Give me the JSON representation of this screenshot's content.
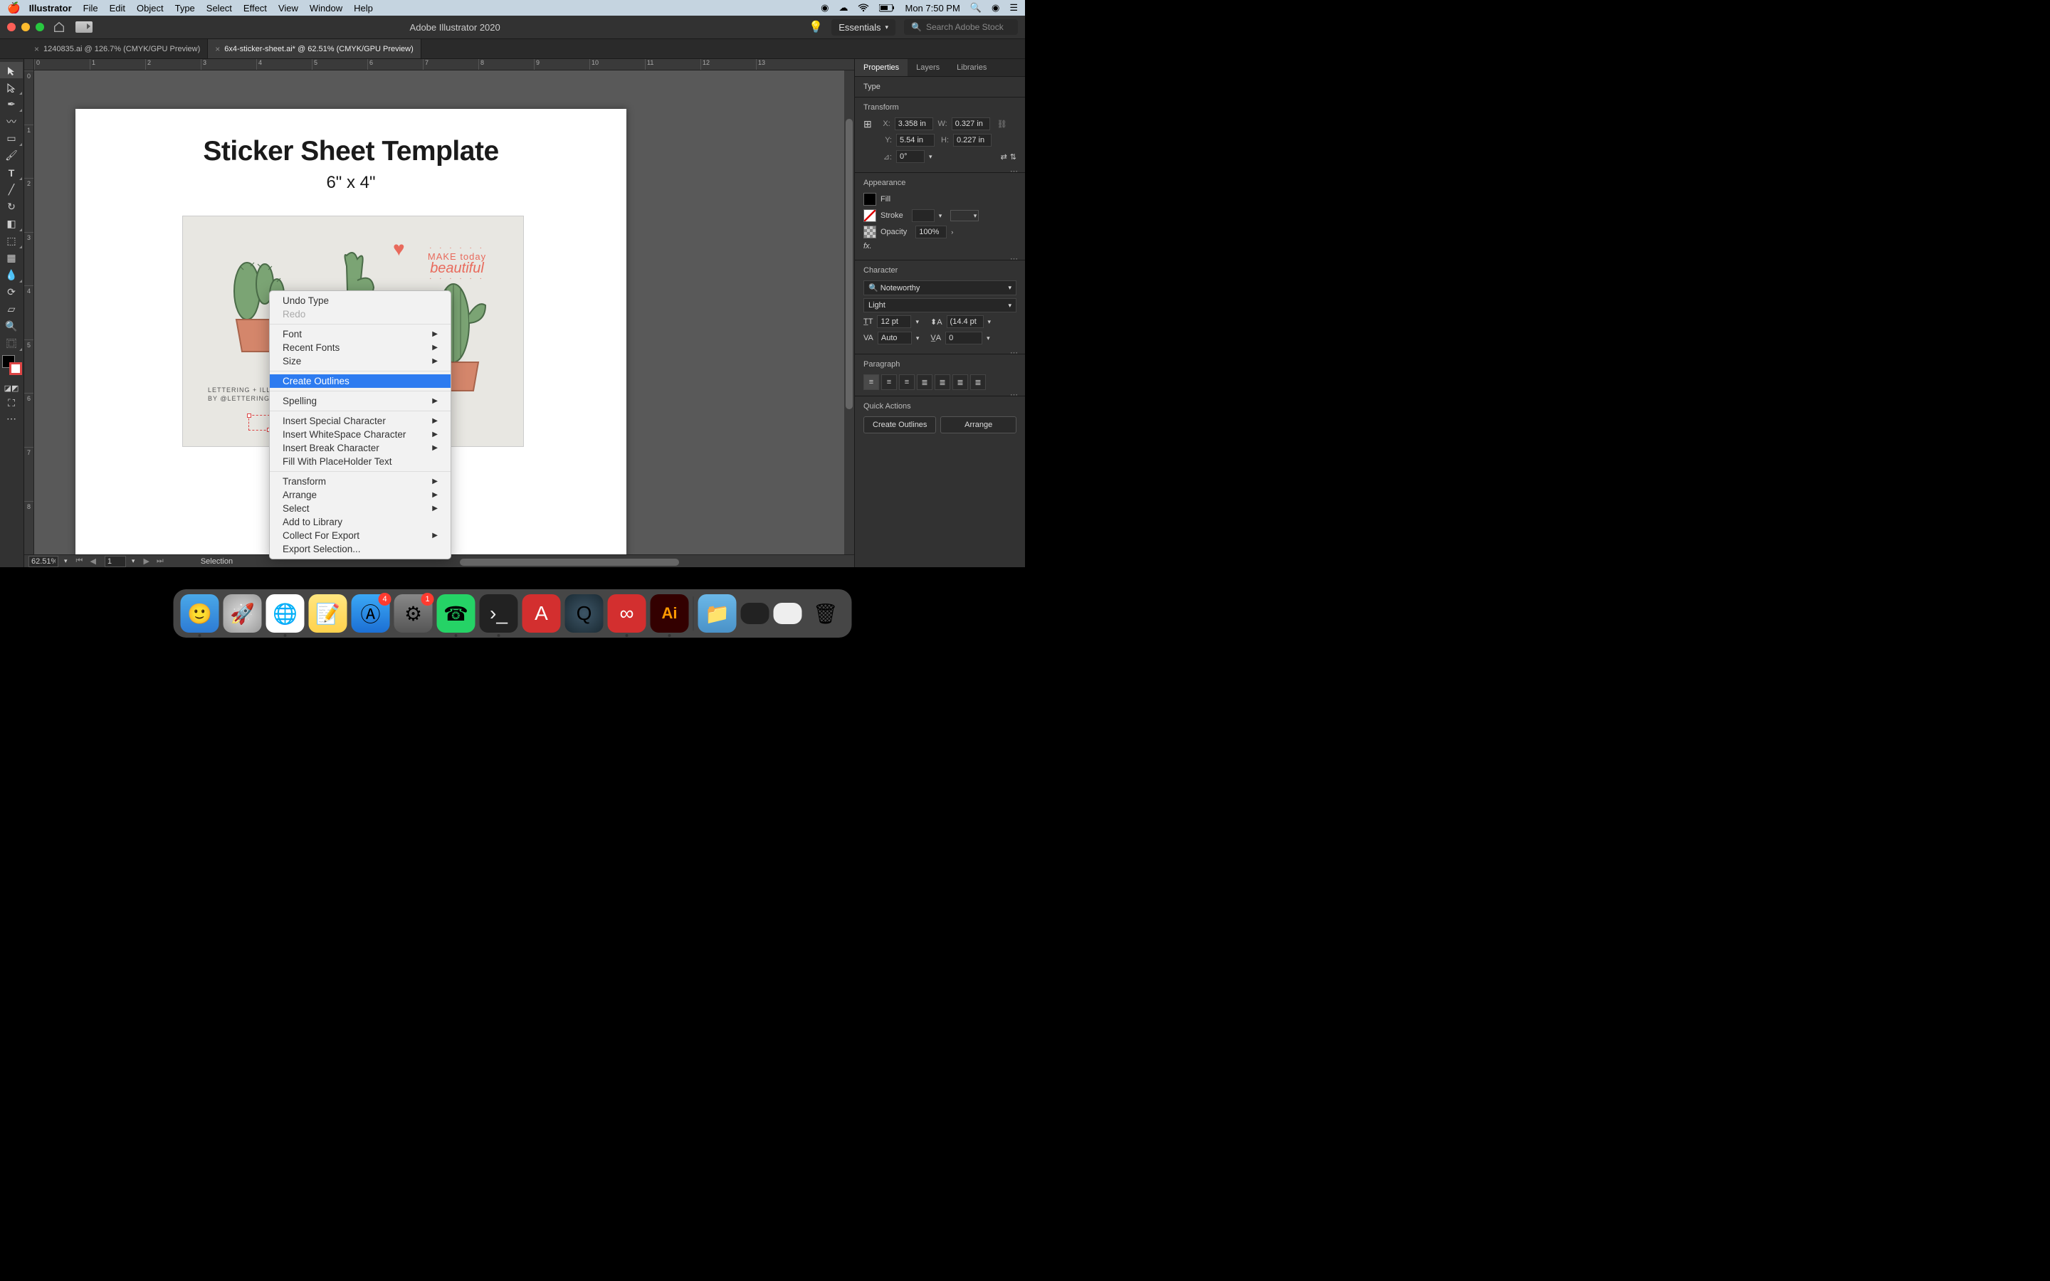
{
  "menubar": {
    "app": "Illustrator",
    "items": [
      "File",
      "Edit",
      "Object",
      "Type",
      "Select",
      "Effect",
      "View",
      "Window",
      "Help"
    ],
    "clock": "Mon 7:50 PM"
  },
  "titlebar": {
    "title": "Adobe Illustrator 2020",
    "workspace": "Essentials",
    "search_placeholder": "Search Adobe Stock"
  },
  "tabs": [
    {
      "label": "1240835.ai @ 126.7% (CMYK/GPU Preview)",
      "active": false
    },
    {
      "label": "6x4-sticker-sheet.ai* @ 62.51% (CMYK/GPU Preview)",
      "active": true
    }
  ],
  "ruler_h": [
    "0",
    "1",
    "2",
    "3",
    "4",
    "5",
    "6",
    "7",
    "8",
    "9",
    "10",
    "11",
    "12",
    "13"
  ],
  "ruler_v": [
    "0",
    "1",
    "2",
    "3",
    "4",
    "5",
    "6",
    "7",
    "8"
  ],
  "artboard": {
    "title": "Sticker Sheet Template",
    "subtitle": "6\" x 4\"",
    "credit_line1": "LETTERING + ILLUSTRATIONS",
    "credit_line2": "BY @LETTERINGBYLAURA",
    "make_today_1": "MAKE today",
    "make_today_2": "beautiful"
  },
  "context_menu": [
    {
      "label": "Undo Type",
      "type": "item"
    },
    {
      "label": "Redo",
      "type": "item",
      "disabled": true
    },
    {
      "type": "sep"
    },
    {
      "label": "Font",
      "type": "sub"
    },
    {
      "label": "Recent Fonts",
      "type": "sub"
    },
    {
      "label": "Size",
      "type": "sub"
    },
    {
      "type": "sep"
    },
    {
      "label": "Create Outlines",
      "type": "item",
      "highlight": true
    },
    {
      "type": "sep"
    },
    {
      "label": "Spelling",
      "type": "sub"
    },
    {
      "type": "sep"
    },
    {
      "label": "Insert Special Character",
      "type": "sub"
    },
    {
      "label": "Insert WhiteSpace Character",
      "type": "sub"
    },
    {
      "label": "Insert Break Character",
      "type": "sub"
    },
    {
      "label": "Fill With PlaceHolder Text",
      "type": "item"
    },
    {
      "type": "sep"
    },
    {
      "label": "Transform",
      "type": "sub"
    },
    {
      "label": "Arrange",
      "type": "sub"
    },
    {
      "label": "Select",
      "type": "sub"
    },
    {
      "label": "Add to Library",
      "type": "item"
    },
    {
      "label": "Collect For Export",
      "type": "sub"
    },
    {
      "label": "Export Selection...",
      "type": "item"
    }
  ],
  "statusbar": {
    "zoom": "62.51%",
    "artboard_num": "1",
    "tool": "Selection"
  },
  "panel": {
    "tabs": [
      "Properties",
      "Layers",
      "Libraries"
    ],
    "type_label": "Type",
    "transform": {
      "heading": "Transform",
      "x": "3.358 in",
      "y": "5.54 in",
      "w": "0.327 in",
      "h": "0.227 in",
      "rotate": "0°"
    },
    "appearance": {
      "heading": "Appearance",
      "fill": "Fill",
      "stroke": "Stroke",
      "opacity": "Opacity",
      "opacity_val": "100%",
      "fx": "fx."
    },
    "character": {
      "heading": "Character",
      "font": "Noteworthy",
      "style": "Light",
      "size": "12 pt",
      "leading": "(14.4 pt",
      "tracking": "Auto",
      "kerning": "0"
    },
    "paragraph": {
      "heading": "Paragraph"
    },
    "quick_actions": {
      "heading": "Quick Actions",
      "btn1": "Create Outlines",
      "btn2": "Arrange"
    }
  },
  "dock": {
    "badges": {
      "appstore": "4",
      "settings": "1"
    }
  }
}
